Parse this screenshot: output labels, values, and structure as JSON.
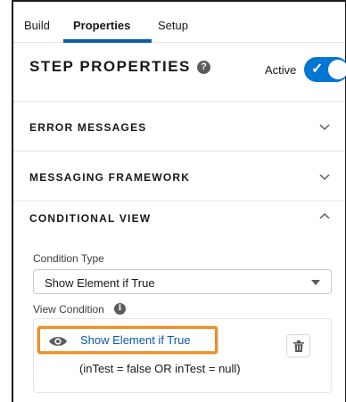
{
  "tabs": {
    "build": "Build",
    "properties": "Properties",
    "setup": "Setup"
  },
  "step": {
    "title": "STEP PROPERTIES",
    "help_icon": "question-icon",
    "active_label": "Active",
    "active_toggle": true
  },
  "sections": {
    "error_messages": "ERROR MESSAGES",
    "messaging_framework": "MESSAGING FRAMEWORK",
    "conditional_view": "CONDITIONAL VIEW"
  },
  "conditional": {
    "condition_type_label": "Condition Type",
    "condition_type_value": "Show Element if True",
    "view_condition_label": "View Condition",
    "info_icon": "info-icon",
    "condition_link": "Show Element if True",
    "condition_expression": "(inTest = false OR inTest = null)",
    "eye_icon": "eye-icon",
    "trash_icon": "trash-icon"
  },
  "colors": {
    "accent": "#0176d3",
    "link": "#0b5cab",
    "highlight": "#e8912d"
  }
}
